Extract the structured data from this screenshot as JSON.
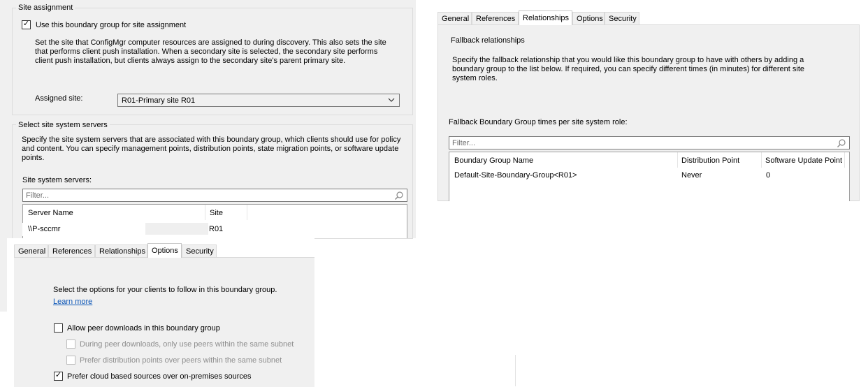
{
  "site_panel": {
    "site_assignment_group": "Site assignment",
    "use_checkbox": {
      "label": "Use this boundary group for site assignment",
      "checked": true
    },
    "description": "Set the site that ConfigMgr computer resources are assigned to during discovery. This also sets the site that performs client push installation. When a secondary site is selected, the secondary site performs client push installation, but clients always assign to the secondary site's parent primary site.",
    "assigned_site_label": "Assigned site:",
    "assigned_site_value": "R01-Primary site R01",
    "servers_group": "Select site system servers",
    "servers_description": "Specify the site system servers that are associated with this boundary group, which clients should use for policy and content. You can specify management points, distribution points, state migration points, or software update points.",
    "servers_label": "Site system servers:",
    "filter_placeholder": "Filter...",
    "columns": [
      "Server Name",
      "Site"
    ],
    "rows": [
      {
        "server": "\\\\P-sccmr",
        "site": "R01"
      }
    ]
  },
  "relationships_panel": {
    "tabs": [
      "General",
      "References",
      "Relationships",
      "Options",
      "Security"
    ],
    "active_tab": "Relationships",
    "heading": "Fallback relationships",
    "description": "Specify the fallback relationship that you would like this boundary group to have with others by adding a boundary group to the list below. If required, you can specify different times (in minutes) for different site system roles.",
    "times_label": "Fallback Boundary Group times per site system role:",
    "filter_placeholder": "Filter...",
    "columns": [
      "Boundary Group Name",
      "Distribution Point",
      "Software Update Point"
    ],
    "rows": [
      {
        "name": "Default-Site-Boundary-Group<R01>",
        "dp": "Never",
        "sup": "0"
      }
    ]
  },
  "options_panel": {
    "tabs": [
      "General",
      "References",
      "Relationships",
      "Options",
      "Security"
    ],
    "active_tab": "Options",
    "intro": "Select the options for your clients to follow in this boundary group.",
    "learn_more": "Learn more",
    "options": [
      {
        "label": "Allow peer downloads in this boundary group",
        "checked": false,
        "enabled": true
      },
      {
        "label": "During peer downloads, only use peers within the same subnet",
        "checked": false,
        "enabled": false
      },
      {
        "label": "Prefer distribution points over peers within the same subnet",
        "checked": false,
        "enabled": false
      },
      {
        "label": "Prefer cloud based sources over on-premises sources",
        "checked": true,
        "enabled": true
      }
    ]
  },
  "icons": {
    "search": "search-icon",
    "chevron": "chevron-down-icon",
    "check": "checkmark-icon"
  }
}
